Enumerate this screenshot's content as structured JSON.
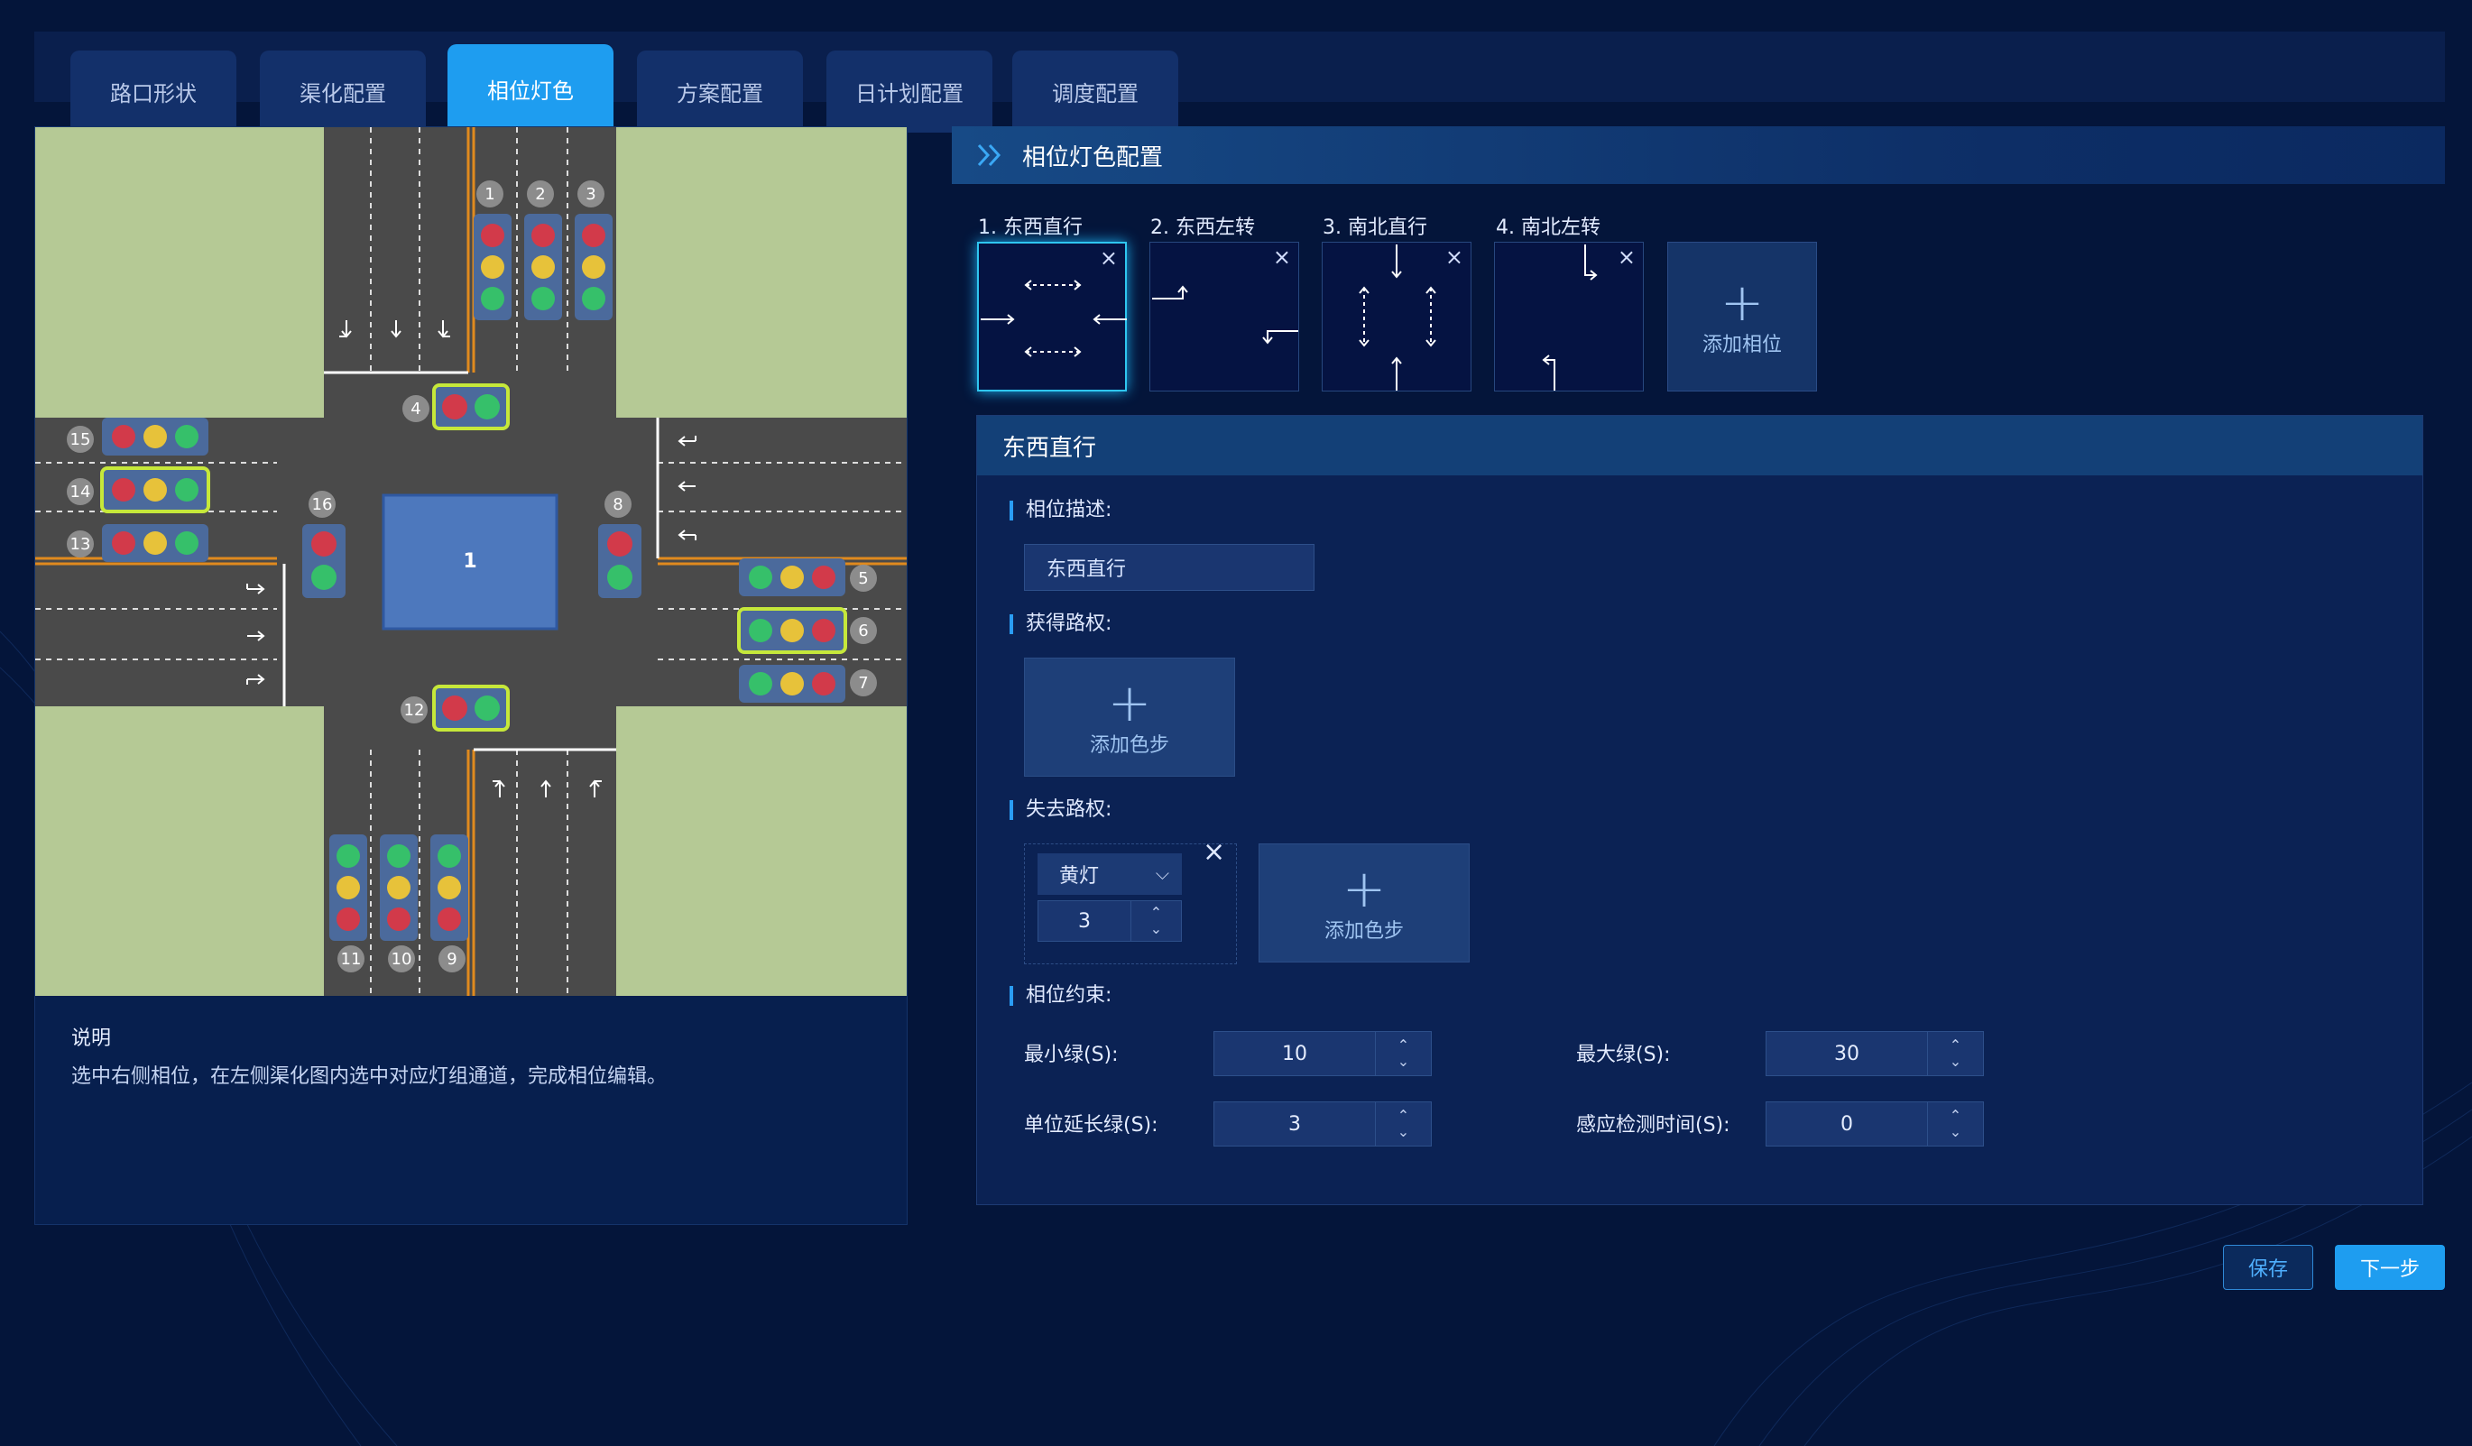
{
  "tabs": [
    "路口形状",
    "渠化配置",
    "相位灯色",
    "方案配置",
    "日计划配置",
    "调度配置"
  ],
  "active_tab": 2,
  "map": {
    "center_label": "1",
    "signal_numbers": [
      "1",
      "2",
      "3",
      "4",
      "5",
      "6",
      "7",
      "8",
      "9",
      "10",
      "11",
      "12",
      "13",
      "14",
      "15",
      "16"
    ]
  },
  "note": {
    "title": "说明",
    "text": "选中右侧相位，在左侧渠化图内选中对应灯组通道，完成相位编辑。"
  },
  "header": {
    "title": "相位灯色配置"
  },
  "phases": [
    {
      "label": "1. 东西直行"
    },
    {
      "label": "2. 东西左转"
    },
    {
      "label": "3. 南北直行"
    },
    {
      "label": "4. 南北左转"
    }
  ],
  "add_phase_label": "添加相位",
  "detail": {
    "title": "东西直行",
    "desc_label": "相位描述:",
    "desc_value": "东西直行",
    "gain_label": "获得路权:",
    "lose_label": "失去路权:",
    "add_step_label": "添加色步",
    "lose_step": {
      "color": "黄灯",
      "duration": "3"
    },
    "constraint_label": "相位约束:",
    "min_green_label": "最小绿(S):",
    "min_green": "10",
    "max_green_label": "最大绿(S):",
    "max_green": "30",
    "unit_ext_label": "单位延长绿(S):",
    "unit_ext": "3",
    "detect_label": "感应检测时间(S):",
    "detect": "0"
  },
  "buttons": {
    "save": "保存",
    "next": "下一步"
  },
  "colors": {
    "accent": "#1e9df0",
    "bg": "#04153a",
    "grass": "#b5c995",
    "road": "#4a4a4a",
    "lane_line": "#e08a1e",
    "signal_border": "#c6e83a"
  }
}
